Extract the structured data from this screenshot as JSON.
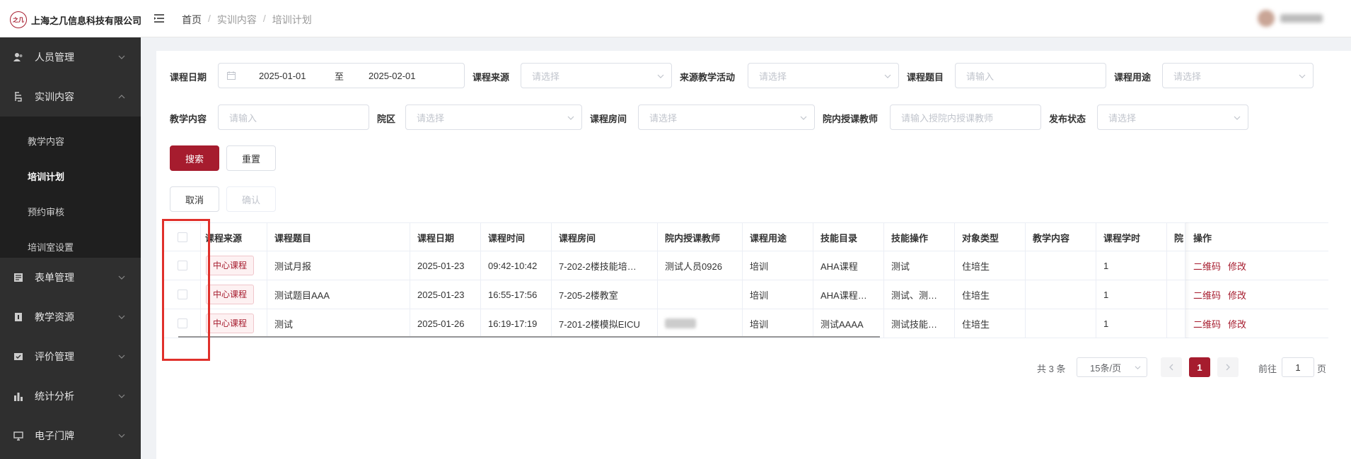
{
  "header": {
    "logo_mark": "之几",
    "company": "上海之几信息科技有限公司",
    "breadcrumb": [
      "首页",
      "实训内容",
      "培训计划"
    ]
  },
  "sidebar": {
    "items": [
      {
        "label": "人员管理",
        "icon": "users-icon"
      },
      {
        "label": "实训内容",
        "icon": "content-icon"
      },
      {
        "label": "表单管理",
        "icon": "form-icon"
      },
      {
        "label": "教学资源",
        "icon": "resource-icon"
      },
      {
        "label": "评价管理",
        "icon": "evaluate-icon"
      },
      {
        "label": "统计分析",
        "icon": "bar-chart-icon"
      },
      {
        "label": "电子门牌",
        "icon": "monitor-icon"
      }
    ],
    "subitems": [
      "教学内容",
      "培训计划",
      "预约审核",
      "培训室设置"
    ],
    "active_sub": "培训计划"
  },
  "filters": {
    "course_date_label": "课程日期",
    "date_start": "2025-01-01",
    "date_sep": "至",
    "date_end": "2025-02-01",
    "course_source_label": "课程来源",
    "course_source_placeholder": "请选择",
    "activity_label": "来源教学活动",
    "activity_placeholder": "请选择",
    "topic_label": "课程题目",
    "topic_placeholder": "请输入",
    "usage_label": "课程用途",
    "usage_placeholder": "请选择",
    "content_label": "教学内容",
    "content_placeholder": "请输入",
    "campus_label": "院区",
    "campus_placeholder": "请选择",
    "room_label": "课程房间",
    "room_placeholder": "请选择",
    "teacher_label": "院内授课教师",
    "teacher_placeholder": "请输入授院内授课教师",
    "publish_label": "发布状态",
    "publish_placeholder": "请选择"
  },
  "buttons": {
    "search": "搜索",
    "reset": "重置",
    "cancel": "取消",
    "confirm": "确认"
  },
  "table": {
    "columns": [
      "课程来源",
      "课程题目",
      "课程日期",
      "课程时间",
      "课程房间",
      "院内授课教师",
      "课程用途",
      "技能目录",
      "技能操作",
      "对象类型",
      "教学内容",
      "课程学时",
      "院",
      "操作"
    ],
    "rows": [
      {
        "source": "中心课程",
        "topic": "测试月报",
        "date": "2025-01-23",
        "time": "09:42-10:42",
        "room": "7-202-2楼技能培…",
        "teacher": "测试人员0926",
        "usage": "培训",
        "skill_dir": "AHA课程",
        "skill_op": "测试",
        "target": "住培生",
        "content": "",
        "hours": "1"
      },
      {
        "source": "中心课程",
        "topic": "测试题目AAA",
        "date": "2025-01-23",
        "time": "16:55-17:56",
        "room": "7-205-2楼教室",
        "teacher": "",
        "usage": "培训",
        "skill_dir": "AHA课程…",
        "skill_op": "测试、测…",
        "target": "住培生",
        "content": "",
        "hours": "1"
      },
      {
        "source": "中心课程",
        "topic": "测试",
        "date": "2025-01-26",
        "time": "16:19-17:19",
        "room": "7-201-2楼模拟EICU",
        "teacher": "",
        "usage": "培训",
        "skill_dir": "测试AAAA",
        "skill_op": "测试技能…",
        "target": "住培生",
        "content": "",
        "hours": "1"
      }
    ],
    "action_qr": "二维码",
    "action_edit": "修改"
  },
  "pagination": {
    "total": "共 3 条",
    "page_size": "15条/页",
    "current": "1",
    "goto_prefix": "前往",
    "goto_value": "1",
    "goto_suffix": "页"
  },
  "colors": {
    "accent": "#a61c2e",
    "sidebar_bg": "#2f2f2f",
    "highlight": "#e0302b"
  }
}
